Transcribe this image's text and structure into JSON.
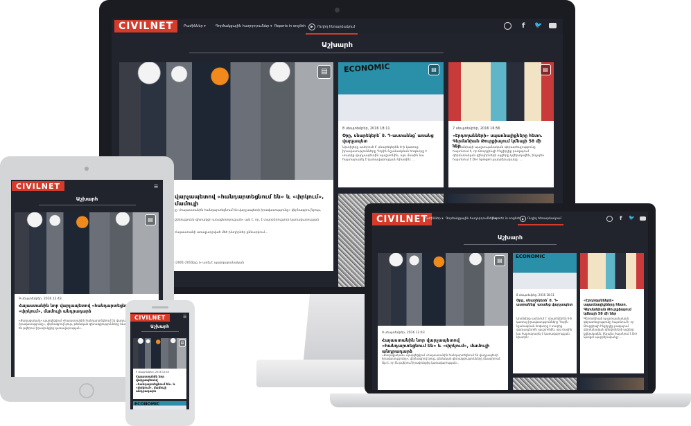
{
  "brand": {
    "logo": "CIVILNET",
    "accent": "#d43b2a",
    "dark_bg": "#21242d"
  },
  "nav": {
    "items": [
      "Բաժիններ",
      "Գործակցային հաղորդումներ",
      "Reports in english"
    ],
    "live_label": "Ուղիղ հեռարձակում",
    "icons": [
      "search-icon",
      "facebook-icon",
      "twitter-icon",
      "youtube-icon"
    ]
  },
  "section_title": "Աշխարհ",
  "cards": [
    {
      "date": "9 սեպտեմբեր, 2016 12:43",
      "title": "Հայաստանին նոր վարչապետով «հանդարտեցնում են» և «փրկում», մամուլի անդրադարձ",
      "excerpt": "«Քաղաքական» պարզեցվում «հայաստանին հանդարտեցնում են վարչապետի իրավասությունը», վերնագրով նյութ, թեմական գիտակցությունները ձևավորում: Այս է, որ են թվերում իրավունքից կառավարության...",
      "desktop_excerpt_fragments": [
        "վարչապետով «հանդարտեցնում են» և «փրկում», մամուլի",
        "յը «հայաստանին հանդարտեցնում են վարչապետի իրավասությունը» վերնագրով նյութ,",
        "քննությունն գիտակցո առաջնորդության» այն է, որ, է տարբերություն կառավարության",
        "Հայաստանի առաջադրված մեծ խնդիրներ քննարկում...",
        "(2001-2010թթ.)» ասել է պարզաբանական"
      ]
    },
    {
      "date": "8 սեպտեմբեր, 2016 18:11",
      "title": "Օրը, սնարեկերե՛ ծ. Դ-աստաննց՝ առանց վարչապետ",
      "excerpt": "Արտիլերը ասերուծ է՝ սնարեկերեն ծ-ի կառուց իրավասությունները Դոբին նշանակման հոգևորը է տարիք վարչապետին պաշտոնին, այս մասին նա հայտարարել է կառավարության նիստին: ..."
    },
    {
      "date": "7 սեպտեմբեր, 2016 16:56",
      "title": "«Էրդողանների» սպառնալիքները հետո. Գերմանիան Թուրքիայում կմնայի 58 մի ներ",
      "excerpt": "Գերմանիայի պաշտպանական գերատեսչությունը հայտնում է, որ Թուրքիայի Ինջիրլիք բազայում գերմանական զինվորների այցերը կվերսկսվեն, ինչպես հայտնում է Der Spiegel պարբերականը: ..."
    }
  ],
  "phone_card": {
    "date": "9 սեպտեմբեր, 2016 12:43",
    "title": "Հայաստանին նոր վարչապետով «հանդարտեցնում են» և «փրկում», մամուլի անդրադարձ"
  }
}
